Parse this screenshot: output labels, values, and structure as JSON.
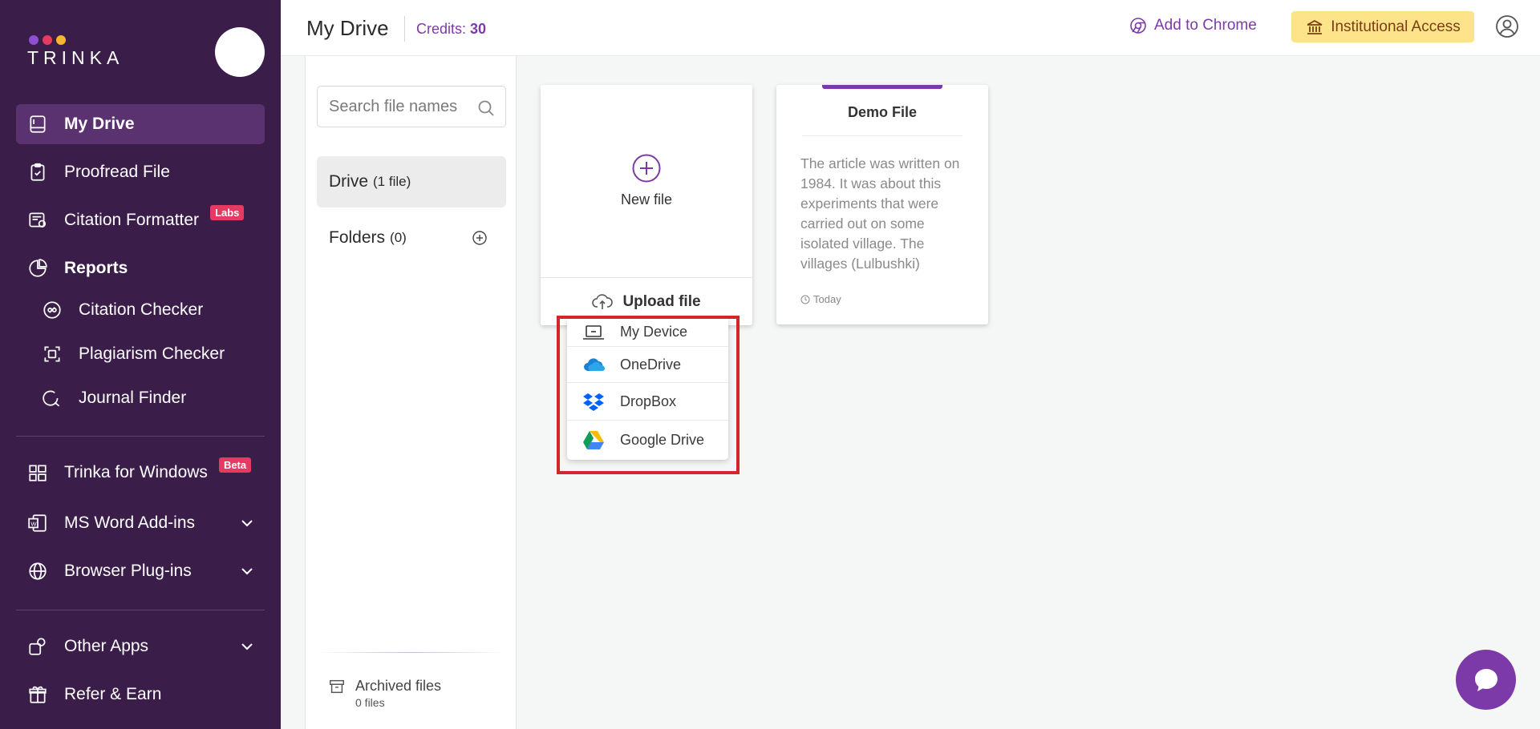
{
  "app": {
    "logo_text": "TRINKA",
    "logo_dot_colors": [
      "#8e4fd4",
      "#e53a62",
      "#f5b52e"
    ]
  },
  "sidebar": {
    "items": [
      {
        "label": "My Drive",
        "icon": "drive-icon",
        "active": true
      },
      {
        "label": "Proofread File",
        "icon": "clipboard-check-icon"
      },
      {
        "label": "Citation Formatter",
        "icon": "citation-formatter-icon",
        "badge": "Labs"
      },
      {
        "label": "Reports",
        "icon": "reports-icon"
      },
      {
        "label": "Citation Checker",
        "icon": "citation-checker-icon"
      },
      {
        "label": "Plagiarism Checker",
        "icon": "plagiarism-icon"
      },
      {
        "label": "Journal Finder",
        "icon": "journal-search-icon"
      },
      {
        "label": "Trinka for Windows",
        "icon": "windows-icon",
        "badge": "Beta"
      },
      {
        "label": "MS Word Add-ins",
        "icon": "word-icon"
      },
      {
        "label": "Browser Plug-ins",
        "icon": "globe-icon"
      },
      {
        "label": "Other Apps",
        "icon": "apps-icon"
      },
      {
        "label": "Refer & Earn",
        "icon": "gift-icon"
      }
    ]
  },
  "header": {
    "title": "My Drive",
    "credits_label": "Credits:",
    "credits_value": "30",
    "add_to_chrome": "Add to Chrome",
    "institutional_access": "Institutional Access"
  },
  "files_panel": {
    "search_placeholder": "Search file names",
    "drive_label": "Drive",
    "drive_count": "(1 file)",
    "folders_label": "Folders",
    "folders_count": "(0)",
    "archived_title": "Archived files",
    "archived_count": "0 files"
  },
  "new_file_card": {
    "label": "New file",
    "upload_label": "Upload file"
  },
  "upload_menu": {
    "items": [
      {
        "label": "My Device",
        "icon": "laptop-icon"
      },
      {
        "label": "OneDrive",
        "icon": "onedrive-icon"
      },
      {
        "label": "DropBox",
        "icon": "dropbox-icon"
      },
      {
        "label": "Google Drive",
        "icon": "google-drive-icon"
      }
    ]
  },
  "demo_card": {
    "title": "Demo File",
    "preview": "The article was written on 1984. It was about this experiments that were carried out on some isolated village. The villages (Lulbushki)",
    "date": "Today"
  },
  "colors": {
    "sidebar_bg": "#3b1d4a",
    "accent": "#7c3aa8",
    "highlight": "#d3262b",
    "institutional_bg": "#fde38a"
  }
}
